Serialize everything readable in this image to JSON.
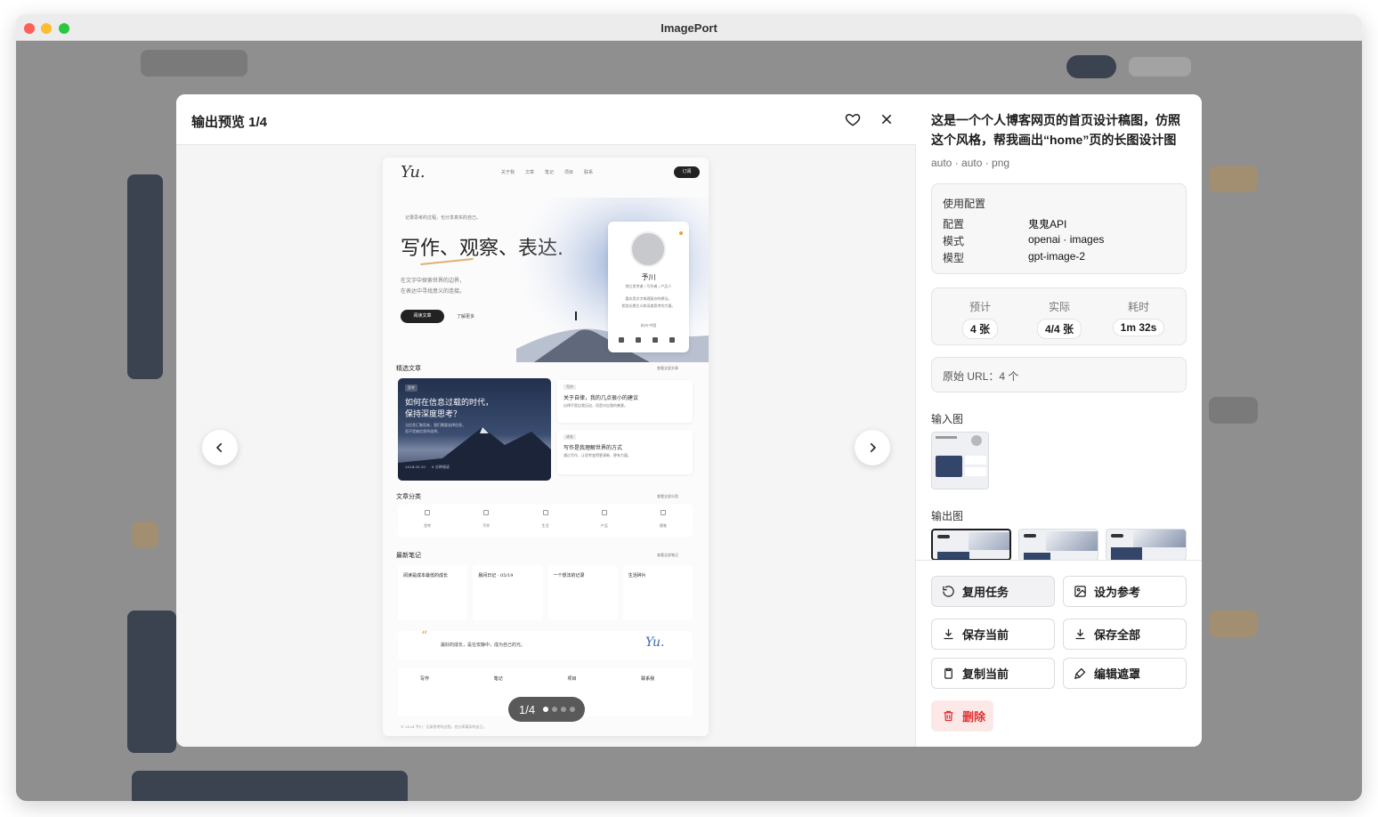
{
  "window": {
    "title": "ImagePort"
  },
  "modal": {
    "title": "输出预览 1/4",
    "pager": "1/4",
    "pager_dots": 4,
    "pager_active": 1
  },
  "preview": {
    "logo": "Yu.",
    "nav": [
      "关于我",
      "文章",
      "笔记",
      "项目",
      "联系"
    ],
    "subscribe": "订阅",
    "tagline": "记录思考的过程，也分享真实的自己。",
    "hero_title": "写作、观察、表达.",
    "hero_sub_1": "在文字中探索世界的边界，",
    "hero_sub_2": "在表达中寻找意义的连接。",
    "read_btn": "阅读文章",
    "more_link": "了解更多",
    "profile_name": "予川",
    "profile_role": "独立思考者 / 写作者 / 产品人",
    "profile_bio_1": "喜欢用文字梳理复杂的想法，",
    "profile_bio_2": "相信长期主义和深度思考的力量。",
    "profile_loc": "杭州·中国",
    "featured_head": "精选文章",
    "featured_more": "查看全部文章",
    "featured_tag": "思考",
    "featured_title_1": "如何在信息过载的时代，",
    "featured_title_2": "保持深度思考？",
    "featured_sub_1": "当信息汇聚而来，我们需要选择信息，",
    "featured_sub_2": "而不是被信息所选择。",
    "featured_date": "2024.05.20",
    "featured_read": "8 分钟阅读",
    "side_tag_1": "写作",
    "side_title_1": "关于自律，我的几点很小的建议",
    "side_sub_1": "自律不是自我压迫，而是对自我的善意。",
    "side_tag_2": "成长",
    "side_title_2": "写作是我理解世界的方式",
    "side_sub_2": "通过写作，让思考变得更清晰、更有力量。",
    "cat_head": "文章分类",
    "cat_more": "查看全部分类",
    "categories": [
      "思考",
      "写作",
      "生活",
      "产品",
      "随笔"
    ],
    "notes_head": "最新笔记",
    "notes_more": "查看全部笔记",
    "notes": [
      "阅读是成本最低的成长",
      "晨间日记 · 05/19",
      "一个想法的记录",
      "生活碎片"
    ],
    "quote": "最好的成长，是在安静中，成为自己的光。",
    "footer_items": [
      "写作",
      "笔记",
      "项目",
      "联系我"
    ],
    "copyright": "© 2024 予川 · 记录思考的过程，也分享真实的自己。"
  },
  "detail": {
    "prompt": "这是一个个人博客网页的首页设计稿图，仿照这个风格，帮我画出“home”页的长图设计图",
    "meta": "auto · auto · png",
    "config_title": "使用配置",
    "config": [
      {
        "k": "配置",
        "v": "鬼鬼API"
      },
      {
        "k": "模式",
        "v": "openai · images"
      },
      {
        "k": "模型",
        "v": "gpt-image-2"
      }
    ],
    "stats": [
      {
        "label": "预计",
        "value": "4 张"
      },
      {
        "label": "实际",
        "value": "4/4 张"
      },
      {
        "label": "耗时",
        "value": "1m 32s"
      }
    ],
    "urls": "原始 URL：4 个",
    "input_label": "输入图",
    "output_label": "输出图",
    "buttons": {
      "reuse": "复用任务",
      "set_ref": "设为参考",
      "save_current": "保存当前",
      "save_all": "保存全部",
      "copy_current": "复制当前",
      "edit_mask": "编辑遮罩",
      "delete": "删除"
    }
  },
  "colors": {
    "accent": "#1d1d1f",
    "danger": "#e03131",
    "danger_bg": "#fde8e8"
  }
}
